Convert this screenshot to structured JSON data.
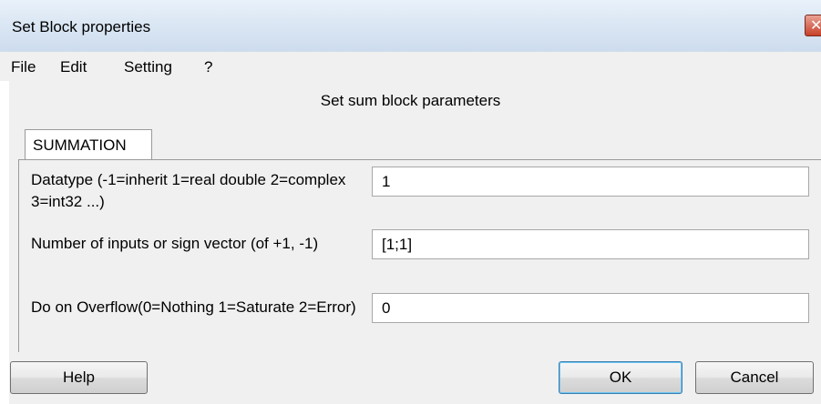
{
  "window": {
    "title": "Set Block properties",
    "close_glyph": "✕"
  },
  "menu": {
    "items": [
      "File",
      "Edit",
      "Setting",
      "?"
    ]
  },
  "header": {
    "text": "Set sum block parameters"
  },
  "tabs": [
    {
      "label": "SUMMATION",
      "selected": true
    }
  ],
  "params": [
    {
      "label": "Datatype (-1=inherit 1=real double 2=complex 3=int32 ...)",
      "value": "1"
    },
    {
      "label": "Number of inputs or sign vector (of +1, -1)",
      "value": "[1;1]"
    },
    {
      "label": "Do on Overflow(0=Nothing 1=Saturate 2=Error)",
      "value": "0"
    }
  ],
  "buttons": {
    "help": "Help",
    "ok": "OK",
    "cancel": "Cancel"
  },
  "icons": {
    "close": "close-icon"
  },
  "colors": {
    "titlebar": "#dbe7f4",
    "close": "#c7412b",
    "dialog_bg": "#f0f0f0",
    "ok_border": "#3c7fb1"
  }
}
